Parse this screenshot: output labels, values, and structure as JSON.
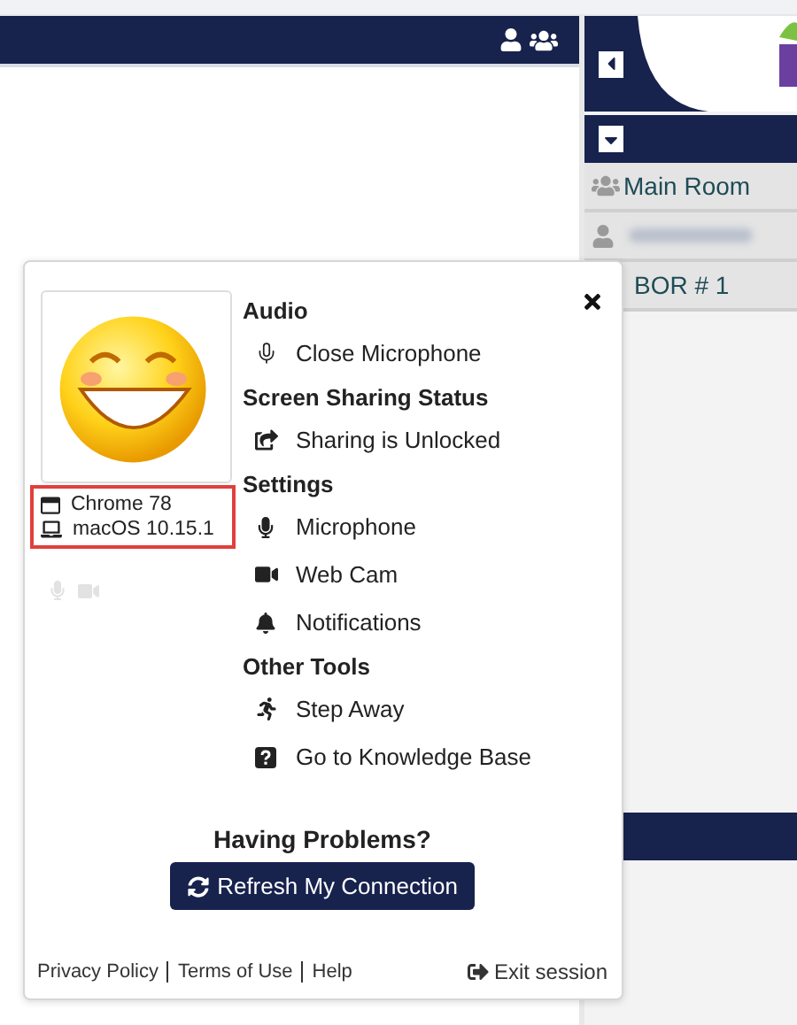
{
  "sidebar": {
    "rooms": [
      {
        "kind": "group",
        "label": "Main Room"
      },
      {
        "kind": "blurred"
      },
      {
        "kind": "plain",
        "label": "BOR # 1"
      }
    ]
  },
  "popup": {
    "client_info": [
      {
        "kind": "browser",
        "text": "Chrome 78"
      },
      {
        "kind": "laptop",
        "text": "macOS 10.15.1"
      }
    ],
    "sections": [
      {
        "title": "Audio",
        "items": [
          {
            "kind": "miclight",
            "label": "Close Microphone"
          }
        ]
      },
      {
        "title": "Screen Sharing Status",
        "items": [
          {
            "kind": "share",
            "label": "Sharing is Unlocked"
          }
        ]
      },
      {
        "title": "Settings",
        "items": [
          {
            "kind": "mic",
            "label": "Microphone"
          },
          {
            "kind": "video",
            "label": "Web Cam"
          },
          {
            "kind": "bell",
            "label": "Notifications"
          }
        ]
      },
      {
        "title": "Other Tools",
        "items": [
          {
            "kind": "run",
            "label": "Step Away"
          },
          {
            "kind": "question",
            "label": "Go to Knowledge Base"
          }
        ]
      }
    ],
    "problems_title": "Having Problems?",
    "refresh_button": "Refresh My Connection",
    "footer_links": [
      "Privacy Policy",
      "Terms of Use",
      "Help"
    ],
    "exit_link": "Exit session"
  }
}
